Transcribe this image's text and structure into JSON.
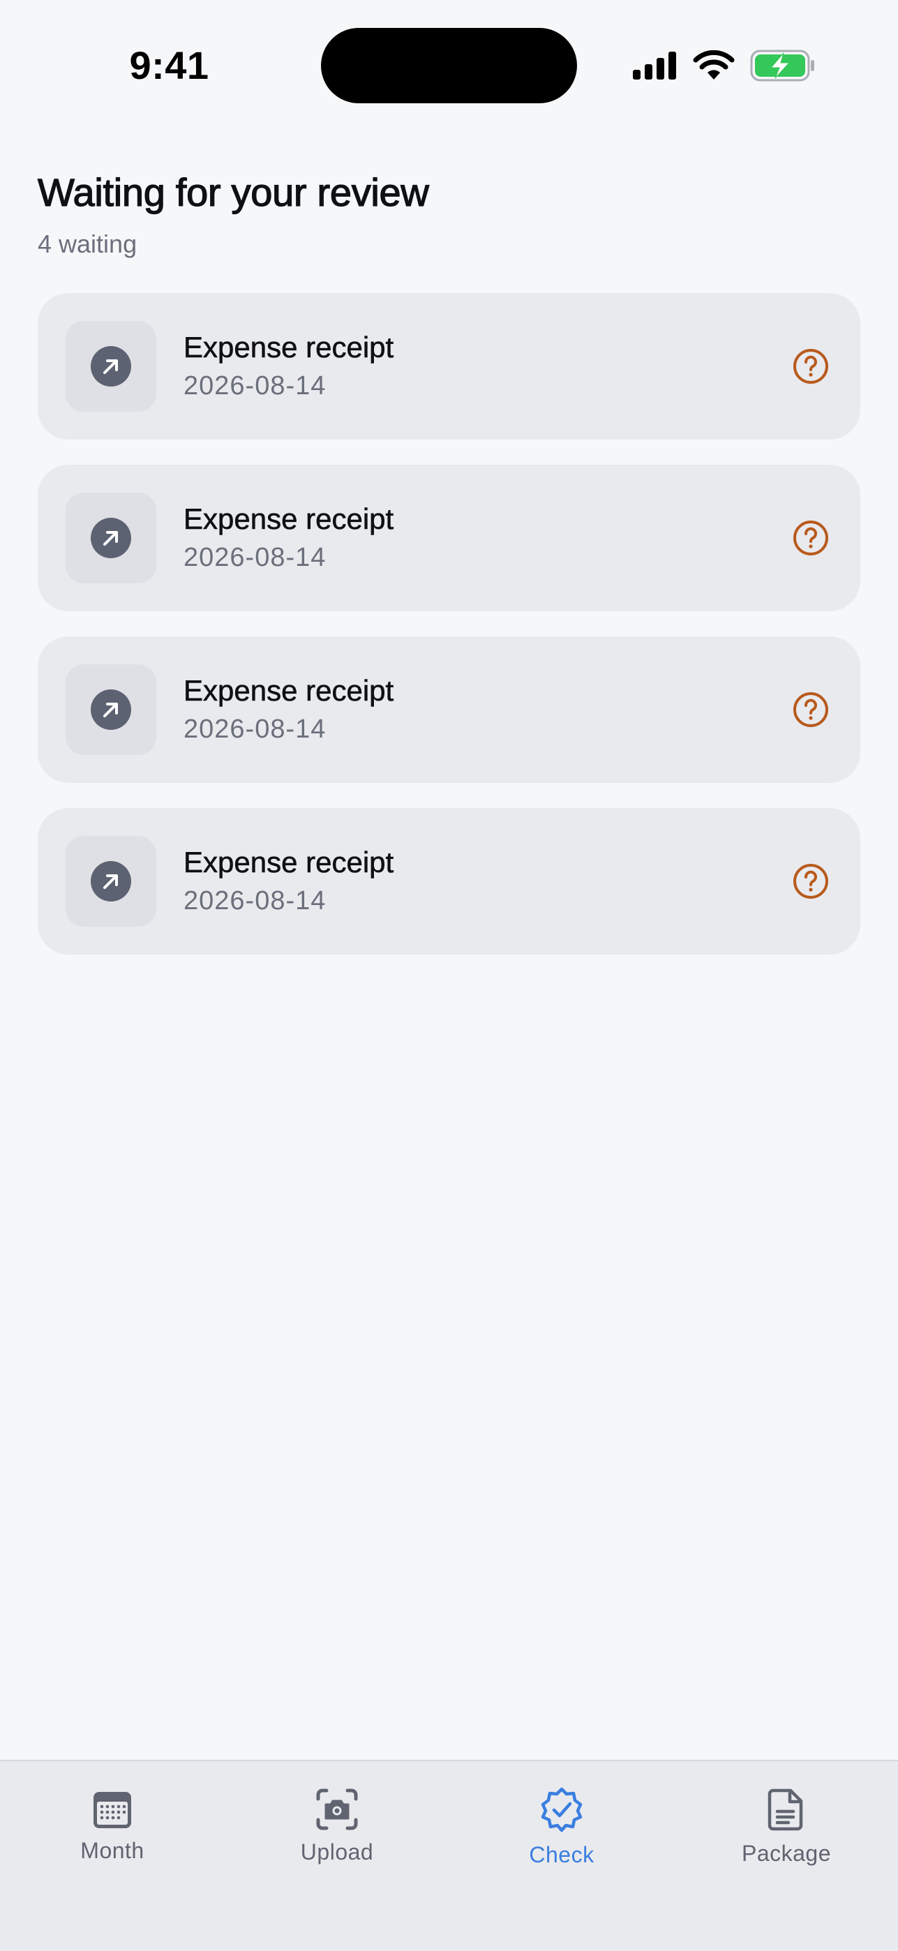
{
  "status_bar": {
    "time": "9:41"
  },
  "header": {
    "title": "Waiting for your review",
    "subtitle": "4 waiting"
  },
  "items": [
    {
      "title": "Expense receipt",
      "date": "2026-08-14",
      "thumb_icon": "arrow-up-right-icon",
      "status_icon": "question-circle-icon"
    },
    {
      "title": "Expense receipt",
      "date": "2026-08-14",
      "thumb_icon": "arrow-up-right-icon",
      "status_icon": "question-circle-icon"
    },
    {
      "title": "Expense receipt",
      "date": "2026-08-14",
      "thumb_icon": "arrow-up-right-icon",
      "status_icon": "question-circle-icon"
    },
    {
      "title": "Expense receipt",
      "date": "2026-08-14",
      "thumb_icon": "arrow-up-right-icon",
      "status_icon": "question-circle-icon"
    }
  ],
  "tabs": [
    {
      "label": "Month",
      "icon": "calendar-icon",
      "active": false
    },
    {
      "label": "Upload",
      "icon": "camera-scan-icon",
      "active": false
    },
    {
      "label": "Check",
      "icon": "verified-badge-icon",
      "active": true
    },
    {
      "label": "Package",
      "icon": "document-icon",
      "active": false
    }
  ],
  "colors": {
    "background": "#f6f7f9",
    "card": "#e9eaee",
    "accent": "#3a7ee0",
    "warning": "#b85a1c",
    "battery": "#34c759",
    "muted_text": "#6a6f7b"
  }
}
